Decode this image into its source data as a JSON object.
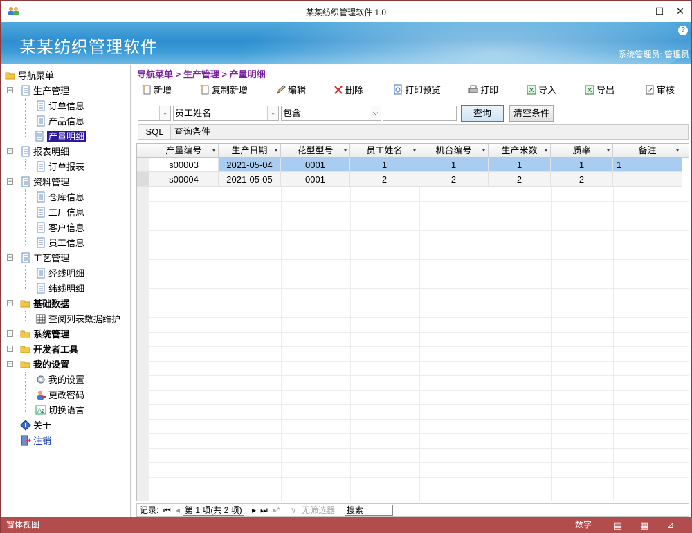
{
  "window": {
    "title": "某某纺织管理软件 1.0",
    "minimize": "–",
    "maximize": "☐",
    "close": "✕"
  },
  "banner": {
    "app_name": "某某纺织管理软件",
    "user_info": "系统管理员: 管理员",
    "help": "?"
  },
  "sidebar": {
    "root": "导航菜单",
    "items": [
      {
        "label": "生产管理"
      },
      {
        "label": "订单信息"
      },
      {
        "label": "产品信息"
      },
      {
        "label": "产量明细"
      },
      {
        "label": "报表明细"
      },
      {
        "label": "订单报表"
      },
      {
        "label": "资料管理"
      },
      {
        "label": "仓库信息"
      },
      {
        "label": "工厂信息"
      },
      {
        "label": "客户信息"
      },
      {
        "label": "员工信息"
      },
      {
        "label": "工艺管理"
      },
      {
        "label": "经线明细"
      },
      {
        "label": "纬线明细"
      },
      {
        "label": "基础数据"
      },
      {
        "label": "查阅列表数据维护"
      },
      {
        "label": "系统管理"
      },
      {
        "label": "开发者工具"
      },
      {
        "label": "我的设置"
      },
      {
        "label": "我的设置"
      },
      {
        "label": "更改密码"
      },
      {
        "label": "切换语言"
      },
      {
        "label": "关于"
      },
      {
        "label": "注销"
      }
    ]
  },
  "breadcrumb": "导航菜单 > 生产管理 > 产量明细",
  "toolbar": {
    "add": "新增",
    "copy_add": "复制新增",
    "edit": "编辑",
    "delete": "删除",
    "print_preview": "打印预览",
    "print": "打印",
    "import": "导入",
    "export": "导出",
    "audit": "审核"
  },
  "filter": {
    "field_prefix": "",
    "field": "员工姓名",
    "operator": "包含",
    "value": "",
    "query_button": "查询",
    "clear_button": "清空条件"
  },
  "sql": {
    "button": "SQL",
    "label": "查询条件"
  },
  "grid": {
    "columns": [
      "产量编号",
      "生产日期",
      "花型型号",
      "员工姓名",
      "机台编号",
      "生产米数",
      "质率",
      "备注"
    ],
    "rows": [
      [
        "s00003",
        "2021-05-04",
        "0001",
        "1",
        "1",
        "1",
        "1",
        "1"
      ],
      [
        "s00004",
        "2021-05-05",
        "0001",
        "2",
        "2",
        "2",
        "2",
        ""
      ]
    ]
  },
  "navbar": {
    "record_label": "记录:",
    "first": "⏮",
    "prev": "◂",
    "position": "第 1 项(共 2 项)",
    "next": "▸",
    "last": "⏭",
    "new": "▸*",
    "filter_status": "无筛选器",
    "search": "搜索"
  },
  "statusbar": {
    "left": "窗体视图",
    "numlock": "数字"
  },
  "colors": {
    "banner": "#2e8fd0",
    "statusbar": "#b34d4d",
    "selection": "#2b1a9b",
    "breadcrumb": "#7b1fa2",
    "row_selected": "#a9cdf0"
  }
}
